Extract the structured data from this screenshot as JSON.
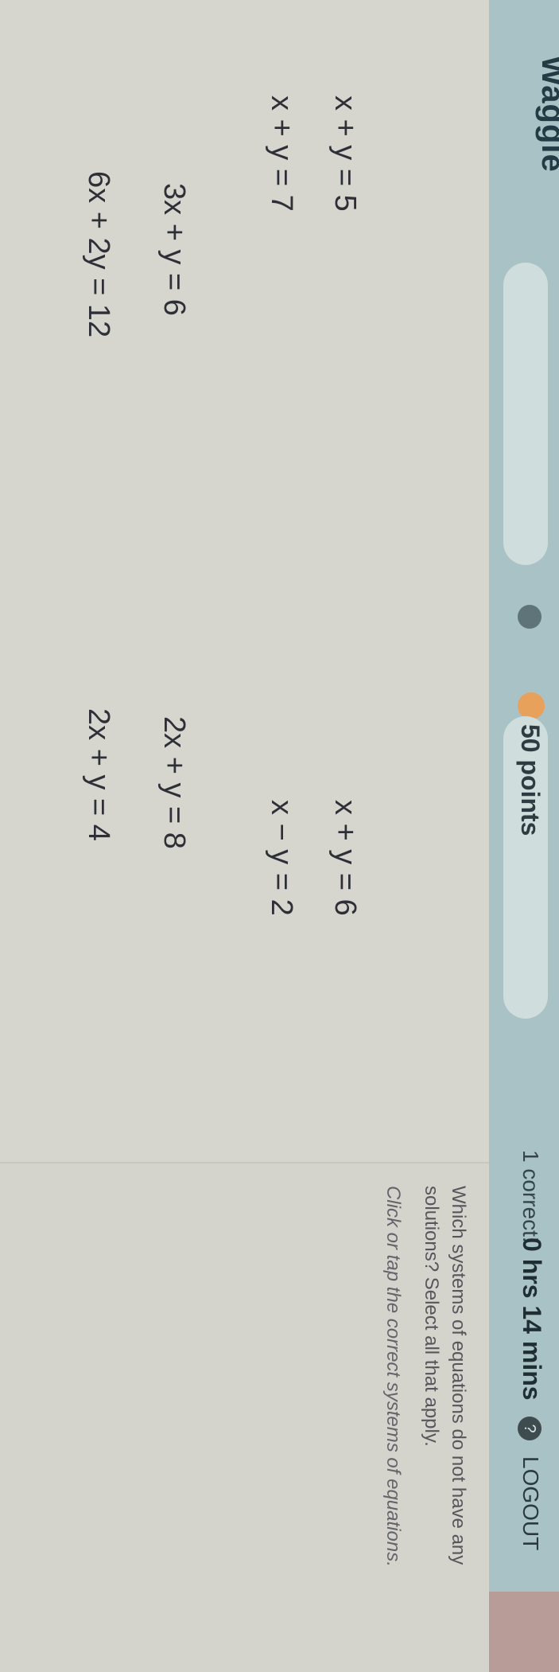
{
  "header": {
    "brand": "Waggle",
    "points": "50 points",
    "correct": "1 correct!",
    "timer": "0 hrs 14 mins",
    "logout": "LOGOUT",
    "help_icon": "?"
  },
  "question": {
    "prompt": "Which systems of equations do not have any solutions? Select all that apply.",
    "hint": "Click or tap the correct systems of equations."
  },
  "options": [
    {
      "eq1": "x + y = 5",
      "eq2": "x + y = 6"
    },
    {
      "eq1": "x + y = 7",
      "eq2": "x − y = 2"
    },
    {
      "eq1": "3x + y = 6",
      "eq2": "2x + y = 8"
    },
    {
      "eq1": "6x + 2y = 12",
      "eq2": "2x + y = 4"
    }
  ]
}
